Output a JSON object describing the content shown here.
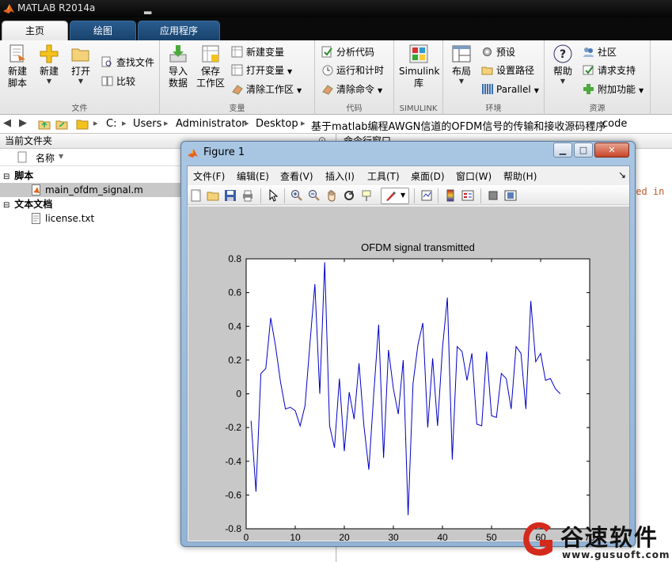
{
  "window": {
    "title": "MATLAB R2014a"
  },
  "tabs": [
    "主页",
    "绘图",
    "应用程序"
  ],
  "ribbon": {
    "file_group": {
      "label": "文件",
      "new_script": [
        "新建",
        "脚本"
      ],
      "new": "新建",
      "open": "打开",
      "find_files": "查找文件",
      "compare": "比较"
    },
    "variable_group": {
      "label": "变量",
      "import": [
        "导入",
        "数据"
      ],
      "save_ws": [
        "保存",
        "工作区"
      ],
      "new_var": "新建变量",
      "open_var": "打开变量",
      "clear_ws": "清除工作区"
    },
    "code_group": {
      "label": "代码",
      "analyze": "分析代码",
      "run_time": "运行和计时",
      "clear_cmd": "清除命令"
    },
    "simulink_group": {
      "label": "SIMULINK",
      "lib": [
        "Simulink",
        "库"
      ]
    },
    "env_group": {
      "label": "环境",
      "layout": "布局",
      "prefs": "预设",
      "set_path": "设置路径",
      "parallel": "Parallel"
    },
    "resources_group": {
      "label": "资源",
      "help": "帮助",
      "community": "社区",
      "support": "请求支持",
      "addons": "附加功能"
    }
  },
  "path": [
    "C:",
    "Users",
    "Administrator",
    "Desktop",
    "基于matlab编程AWGN信道的OFDM信号的传输和接收源码程序",
    "code"
  ],
  "left_panel": {
    "title": "当前文件夹",
    "column": "名称",
    "groups": [
      {
        "name": "脚本",
        "files": [
          "main_ofdm_signal.m"
        ]
      },
      {
        "name": "文本文档",
        "files": [
          "license.txt"
        ]
      }
    ]
  },
  "right_panel": {
    "title": "命令行窗口",
    "visible_text": "ved in"
  },
  "figure": {
    "title": "Figure 1",
    "menu": [
      "文件(F)",
      "编辑(E)",
      "查看(V)",
      "插入(I)",
      "工具(T)",
      "桌面(D)",
      "窗口(W)",
      "帮助(H)"
    ],
    "corner_arrow": "↘"
  },
  "watermark": {
    "text": "谷速软件",
    "url": "www.gusuoft.com"
  },
  "chart_data": {
    "type": "line",
    "title": "OFDM signal transmitted",
    "xlabel": "",
    "ylabel": "",
    "xlim": [
      0,
      70
    ],
    "ylim": [
      -0.8,
      0.8
    ],
    "xticks": [
      0,
      10,
      20,
      30,
      40,
      50,
      60,
      70
    ],
    "yticks": [
      0.8,
      0.6,
      0.4,
      0.2,
      0,
      -0.2,
      -0.4,
      -0.6,
      -0.8
    ],
    "grid": false,
    "line_color": "#0000c8",
    "x": [
      1,
      2,
      3,
      4,
      5,
      6,
      7,
      8,
      9,
      10,
      11,
      12,
      13,
      14,
      15,
      16,
      17,
      18,
      19,
      20,
      21,
      22,
      23,
      24,
      25,
      26,
      27,
      28,
      29,
      30,
      31,
      32,
      33,
      34,
      35,
      36,
      37,
      38,
      39,
      40,
      41,
      42,
      43,
      44,
      45,
      46,
      47,
      48,
      49,
      50,
      51,
      52,
      53,
      54,
      55,
      56,
      57,
      58,
      59,
      60,
      61,
      62,
      63,
      64
    ],
    "y": [
      -0.16,
      -0.58,
      0.12,
      0.15,
      0.45,
      0.28,
      0.07,
      -0.09,
      -0.08,
      -0.1,
      -0.19,
      -0.07,
      0.3,
      0.65,
      0.0,
      0.78,
      -0.19,
      -0.32,
      0.09,
      -0.34,
      0.01,
      -0.15,
      0.18,
      -0.19,
      -0.45,
      0.0,
      0.41,
      -0.38,
      0.26,
      0.03,
      -0.12,
      0.2,
      -0.72,
      0.06,
      0.29,
      0.42,
      -0.2,
      0.21,
      -0.19,
      0.27,
      0.57,
      -0.39,
      0.28,
      0.25,
      0.08,
      0.24,
      -0.18,
      -0.19,
      0.25,
      -0.13,
      -0.14,
      0.12,
      0.09,
      -0.09,
      0.28,
      0.24,
      -0.09,
      0.55,
      0.19,
      0.24,
      0.08,
      0.09,
      0.03,
      0.0
    ]
  }
}
